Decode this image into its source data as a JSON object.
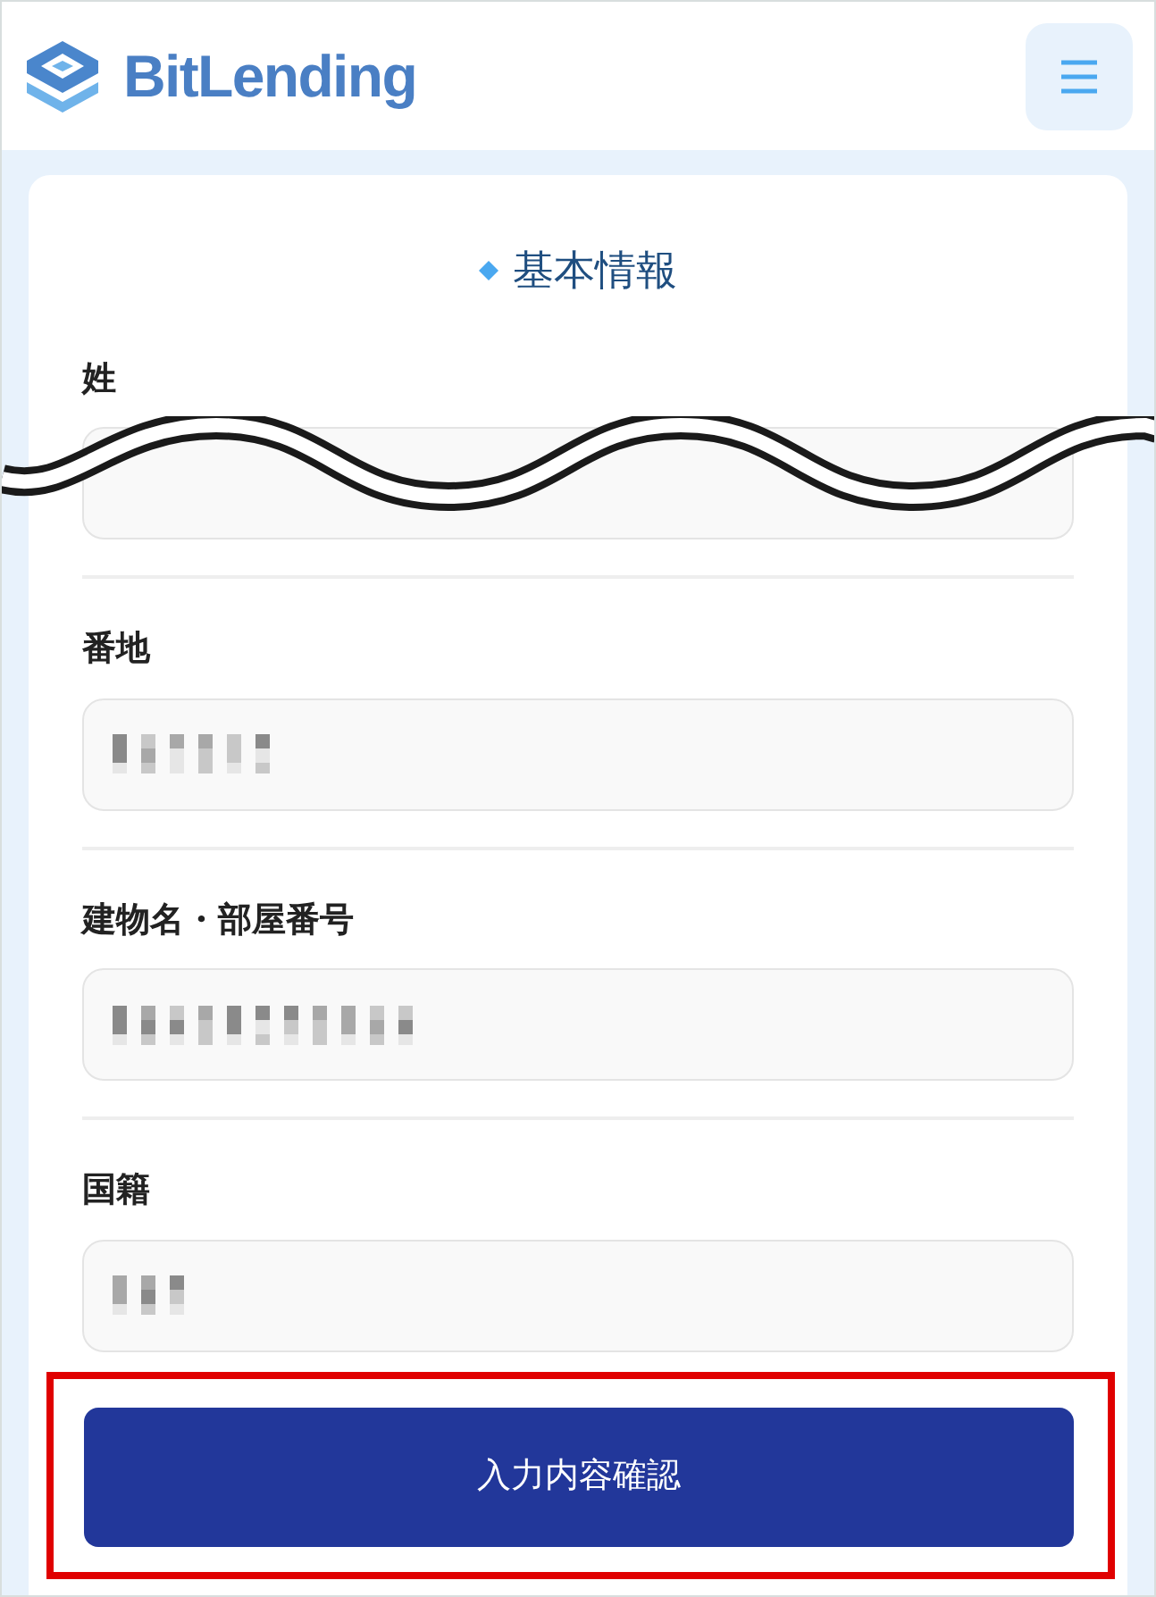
{
  "header": {
    "logo_text": "BitLending"
  },
  "section": {
    "title": "基本情報"
  },
  "fields": [
    {
      "label": "姓",
      "kind": "cut"
    },
    {
      "label": "番地",
      "kind": "redacted"
    },
    {
      "label": "建物名・部屋番号",
      "kind": "redacted"
    },
    {
      "label": "国籍",
      "kind": "redacted"
    }
  ],
  "submit": {
    "label": "入力内容確認",
    "highlighted": true
  }
}
